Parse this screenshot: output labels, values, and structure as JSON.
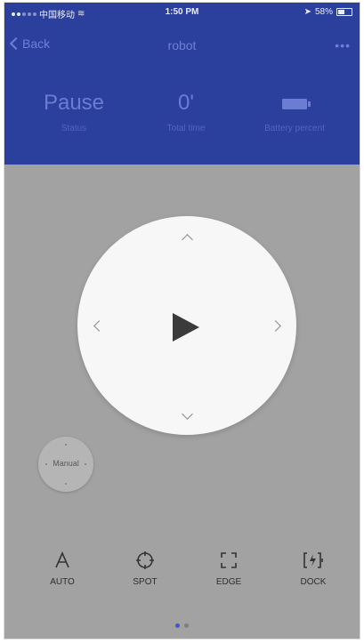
{
  "status_bar": {
    "carrier": "中国移动",
    "time": "1:50 PM",
    "battery_percent": "58%"
  },
  "nav": {
    "back_label": "Back",
    "title": "robot",
    "more_label": "•••"
  },
  "stats": {
    "status": {
      "value": "Pause",
      "label": "Status"
    },
    "total_time": {
      "value": "0'",
      "label": "Total time"
    },
    "battery": {
      "label": "Battery percent"
    }
  },
  "manual": {
    "label": "Manual"
  },
  "modes": [
    {
      "label": "AUTO",
      "icon": "letter-a-icon"
    },
    {
      "label": "SPOT",
      "icon": "spot-crosshair-icon"
    },
    {
      "label": "EDGE",
      "icon": "edge-corners-icon"
    },
    {
      "label": "DOCK",
      "icon": "dock-charging-icon"
    }
  ],
  "pager": {
    "pages": 2,
    "active_index": 0
  },
  "colors": {
    "header": "#2b3f9c",
    "overlay": "#a2a2a2",
    "pad": "#f7f7f7",
    "accent": "#3b57d1"
  }
}
